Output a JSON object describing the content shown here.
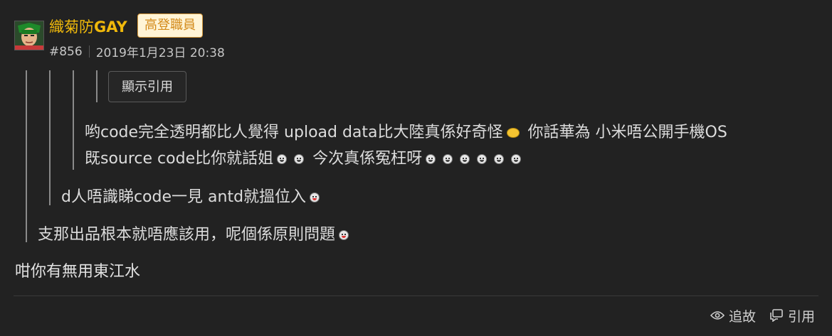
{
  "post": {
    "username_cjk": "織菊防",
    "username_latin": "GAY",
    "badge": "高登職員",
    "post_number": "#856",
    "timestamp": "2019年1月23日 20:38",
    "show_quote_label": "顯示引用",
    "quote_level3_line1_a": "哟code完全透明都比人覺得 upload data比大陸真係好奇怪",
    "quote_level3_line1_b": " 你話華為 小米唔公開手機OS",
    "quote_level3_line2_a": "既source code比你就話姐",
    "quote_level3_line2_b": " 今次真係冤枉呀",
    "quote_level2": "d人唔識睇code一見 antd就搵位入",
    "quote_level1": "支那出品根本就唔應該用，呢個係原則問題",
    "reply": "咁你有無用東江水",
    "actions": {
      "follow_label": "追故",
      "quote_label": "引用"
    },
    "icons": {
      "avatar": "avatar-image",
      "follow": "eye-icon",
      "quote": "quote-icon",
      "emoticons": "emoticon-icon"
    },
    "colors": {
      "background": "#222222",
      "username": "#f0b90b",
      "badge_bg": "#fff4d6",
      "badge_text": "#d38a1a",
      "text": "#dcdcdc"
    }
  }
}
